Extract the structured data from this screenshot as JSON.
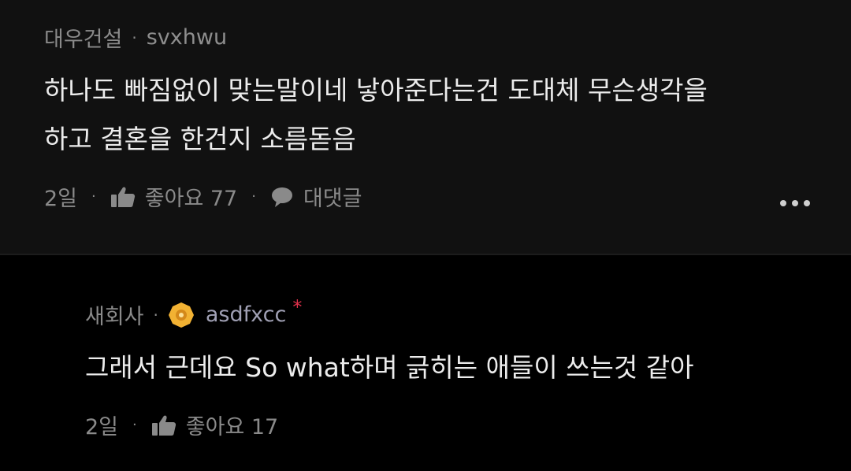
{
  "top_comment": {
    "company": "대우건설",
    "separator": "·",
    "username": "svxhwu",
    "body_line1": "하나도 빠짐없이 맞는말이네 낳아준다는건 도대체 무슨생각을",
    "body_line2": "하고 결혼을 한건지 소름돋음",
    "time": "2일",
    "like_label": "좋아요 77",
    "reply_label": "대댓글",
    "dot": "·",
    "more_icon": "more-horizontal-icon"
  },
  "reply_comment": {
    "company": "새회사",
    "separator": "·",
    "username": "asdfxcc",
    "op_mark": "*",
    "body": "그래서 근데요 So what하며 긁히는 애들이 쓰는것 같아",
    "time": "2일",
    "like_label": "좋아요 17",
    "dot": "·",
    "badge_icon": "gold-badge-icon"
  },
  "colors": {
    "background": "#000000",
    "top_comment_bg": "#111111",
    "text_primary": "#ececec",
    "text_secondary": "#8a8a8a",
    "op_mark": "#e0314b",
    "badge": "#f2b233"
  }
}
